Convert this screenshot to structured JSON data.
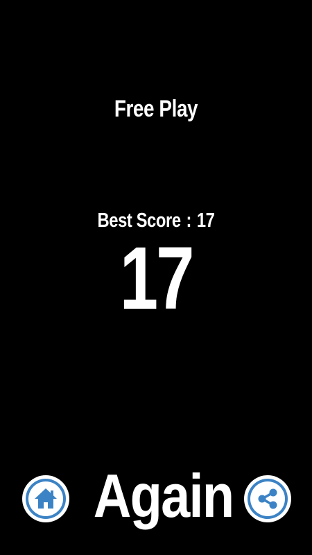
{
  "game": {
    "mode_title": "Free Play",
    "best_score_label": "Best Score",
    "best_score_separator": ":",
    "best_score_value": "17",
    "current_score": "17"
  },
  "controls": {
    "again_label": "Again",
    "home_icon": "home-icon",
    "share_icon": "share-icon"
  },
  "colors": {
    "background": "#000000",
    "text": "#ffffff",
    "accent": "#3c83c5"
  }
}
